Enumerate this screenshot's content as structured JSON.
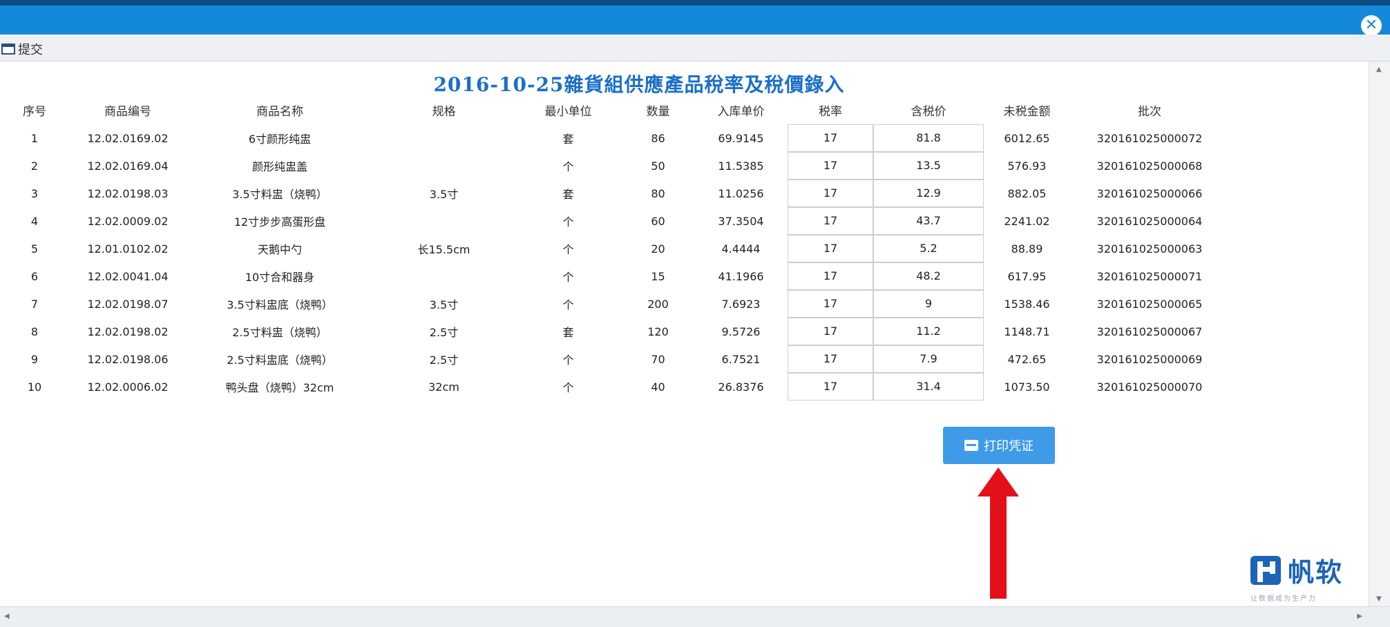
{
  "window": {
    "close_icon": "close-circle-icon"
  },
  "toolbar": {
    "submit_label": "提交",
    "submit_icon": "window-icon"
  },
  "report": {
    "title": "2016-10-25雜貨組供應產品稅率及稅價錄入",
    "columns": [
      "序号",
      "商品编号",
      "商品名称",
      "规格",
      "最小单位",
      "数量",
      "入库单价",
      "税率",
      "含税价",
      "未税金额",
      "批次"
    ],
    "rows": [
      [
        "1",
        "12.02.0169.02",
        "6寸颜形纯盅",
        "",
        "套",
        "86",
        "69.9145",
        "17",
        "81.8",
        "6012.65",
        "320161025000072"
      ],
      [
        "2",
        "12.02.0169.04",
        "颜形纯盅盖",
        "",
        "个",
        "50",
        "11.5385",
        "17",
        "13.5",
        "576.93",
        "320161025000068"
      ],
      [
        "3",
        "12.02.0198.03",
        "3.5寸料盅（烧鸭）",
        "3.5寸",
        "套",
        "80",
        "11.0256",
        "17",
        "12.9",
        "882.05",
        "320161025000066"
      ],
      [
        "4",
        "12.02.0009.02",
        "12寸步步高蛋形盘",
        "",
        "个",
        "60",
        "37.3504",
        "17",
        "43.7",
        "2241.02",
        "320161025000064"
      ],
      [
        "5",
        "12.01.0102.02",
        "天鹅中勺",
        "长15.5cm",
        "个",
        "20",
        "4.4444",
        "17",
        "5.2",
        "88.89",
        "320161025000063"
      ],
      [
        "6",
        "12.02.0041.04",
        "10寸合和器身",
        "",
        "个",
        "15",
        "41.1966",
        "17",
        "48.2",
        "617.95",
        "320161025000071"
      ],
      [
        "7",
        "12.02.0198.07",
        "3.5寸料盅底（烧鸭）",
        "3.5寸",
        "个",
        "200",
        "7.6923",
        "17",
        "9",
        "1538.46",
        "320161025000065"
      ],
      [
        "8",
        "12.02.0198.02",
        "2.5寸料盅（烧鸭）",
        "2.5寸",
        "套",
        "120",
        "9.5726",
        "17",
        "11.2",
        "1148.71",
        "320161025000067"
      ],
      [
        "9",
        "12.02.0198.06",
        "2.5寸料盅底（烧鸭）",
        "2.5寸",
        "个",
        "70",
        "6.7521",
        "17",
        "7.9",
        "472.65",
        "320161025000069"
      ],
      [
        "10",
        "12.02.0006.02",
        "鸭头盘（烧鸭）32cm",
        "32cm",
        "个",
        "40",
        "26.8376",
        "17",
        "31.4",
        "1073.50",
        "320161025000070"
      ]
    ]
  },
  "print_button": {
    "label": "打印凭证",
    "icon": "printer-icon"
  },
  "annotation": {
    "arrow_color": "#e3101a"
  },
  "logo": {
    "brand": "帆软",
    "tagline": "让数据成为生产力"
  },
  "colors": {
    "title_bar": "#1589d9",
    "report_title": "#1a6fc9",
    "button": "#3f9be8"
  }
}
